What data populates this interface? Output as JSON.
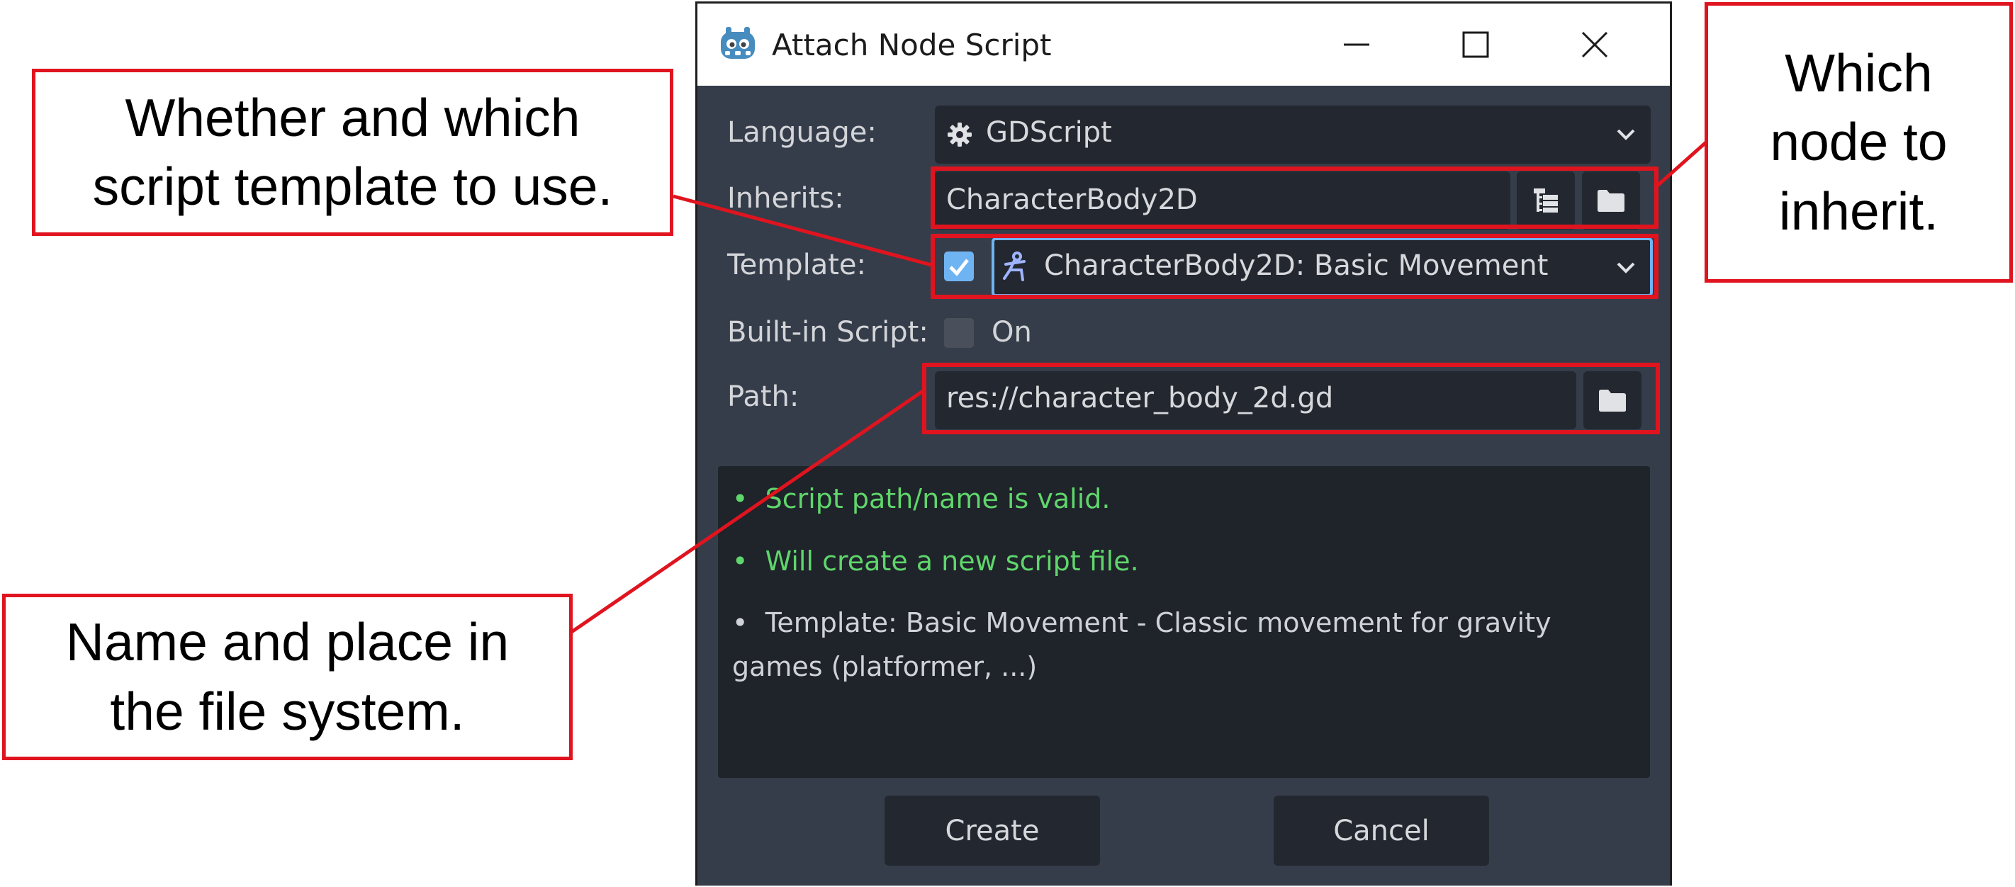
{
  "dialog": {
    "title": "Attach Node Script",
    "language": {
      "label": "Language:",
      "value": "GDScript"
    },
    "inherits": {
      "label": "Inherits:",
      "value": "CharacterBody2D"
    },
    "template": {
      "label": "Template:",
      "checked": true,
      "value": "CharacterBody2D: Basic Movement"
    },
    "builtin": {
      "label": "Built-in Script:",
      "checked": false,
      "toggle_text": "On"
    },
    "path": {
      "label": "Path:",
      "value": "res://character_body_2d.gd"
    },
    "messages": [
      {
        "text": "Script path/name is valid.",
        "color": "#5fd66b"
      },
      {
        "text": "Will create a new script file.",
        "color": "#5fd66b"
      },
      {
        "line1": "Template: Basic Movement - Classic movement for gravity",
        "line2": "games (platformer, ...)",
        "color": "#cfd2d6"
      }
    ],
    "bullet": "•",
    "create_label": "Create",
    "cancel_label": "Cancel"
  },
  "annotations": {
    "template_note": {
      "line1": "Whether and which",
      "line2": "script template to use."
    },
    "inherit_note": {
      "line1": "Which",
      "line2": "node to",
      "line3": "inherit."
    },
    "path_note": {
      "line1": "Name and place in",
      "line2": "the file system."
    }
  },
  "colors": {
    "annotation": "#e0141f",
    "dialog_bg": "#363d4a",
    "field_bg": "#232830",
    "accent": "#6fb4f2"
  },
  "icons": {
    "logo": "godot-logo-icon",
    "language": "gear-icon",
    "template": "node-icon",
    "dropdown": "chevron-down-icon",
    "tree": "tree-icon",
    "folder": "folder-icon"
  }
}
